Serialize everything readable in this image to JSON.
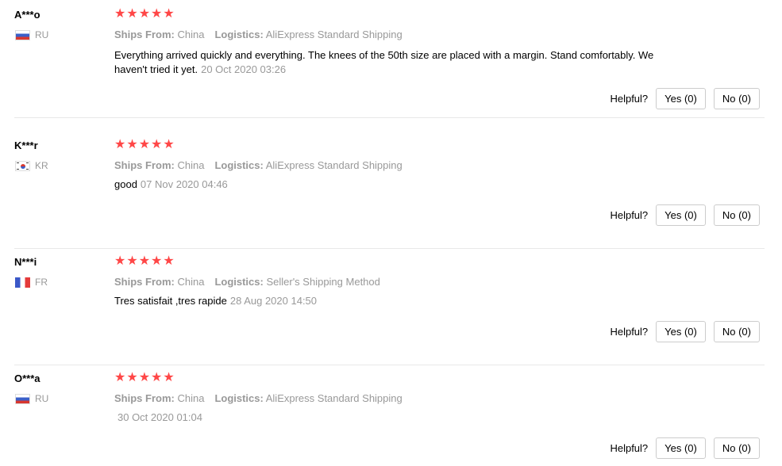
{
  "star_color": "#ff4747",
  "reviews": [
    {
      "user": "A***o",
      "country": "RU",
      "flag": "russia-flag",
      "rating": 5,
      "stars": [
        "★",
        "★",
        "★",
        "★",
        "★"
      ],
      "ships_from_label": "Ships From:",
      "ships_from": "China",
      "logistics_label": "Logistics:",
      "logistics": "AliExpress Standard Shipping",
      "text": "Everything arrived quickly and everything. The knees of the 50th size are placed with a margin. Stand comfortably. We haven't tried it yet.",
      "date": "20 Oct 2020 03:26",
      "helpful_label": "Helpful?",
      "yes_label": "Yes (0)",
      "no_label": "No (0)"
    },
    {
      "user": "K***r",
      "country": "KR",
      "flag": "south-korea-flag",
      "rating": 5,
      "stars": [
        "★",
        "★",
        "★",
        "★",
        "★"
      ],
      "ships_from_label": "Ships From:",
      "ships_from": "China",
      "logistics_label": "Logistics:",
      "logistics": "AliExpress Standard Shipping",
      "text": "good",
      "date": "07 Nov 2020 04:46",
      "helpful_label": "Helpful?",
      "yes_label": "Yes (0)",
      "no_label": "No (0)"
    },
    {
      "user": "N***i",
      "country": "FR",
      "flag": "france-flag",
      "rating": 5,
      "stars": [
        "★",
        "★",
        "★",
        "★",
        "★"
      ],
      "ships_from_label": "Ships From:",
      "ships_from": "China",
      "logistics_label": "Logistics:",
      "logistics": "Seller's Shipping Method",
      "text": "Tres satisfait ,tres rapide",
      "date": "28 Aug 2020 14:50",
      "helpful_label": "Helpful?",
      "yes_label": "Yes (0)",
      "no_label": "No (0)"
    },
    {
      "user": "O***a",
      "country": "RU",
      "flag": "russia-flag",
      "rating": 5,
      "stars": [
        "★",
        "★",
        "★",
        "★",
        "★"
      ],
      "ships_from_label": "Ships From:",
      "ships_from": "China",
      "logistics_label": "Logistics:",
      "logistics": "AliExpress Standard Shipping",
      "text": "",
      "date": "30 Oct 2020 01:04",
      "helpful_label": "Helpful?",
      "yes_label": "Yes (0)",
      "no_label": "No (0)"
    }
  ]
}
